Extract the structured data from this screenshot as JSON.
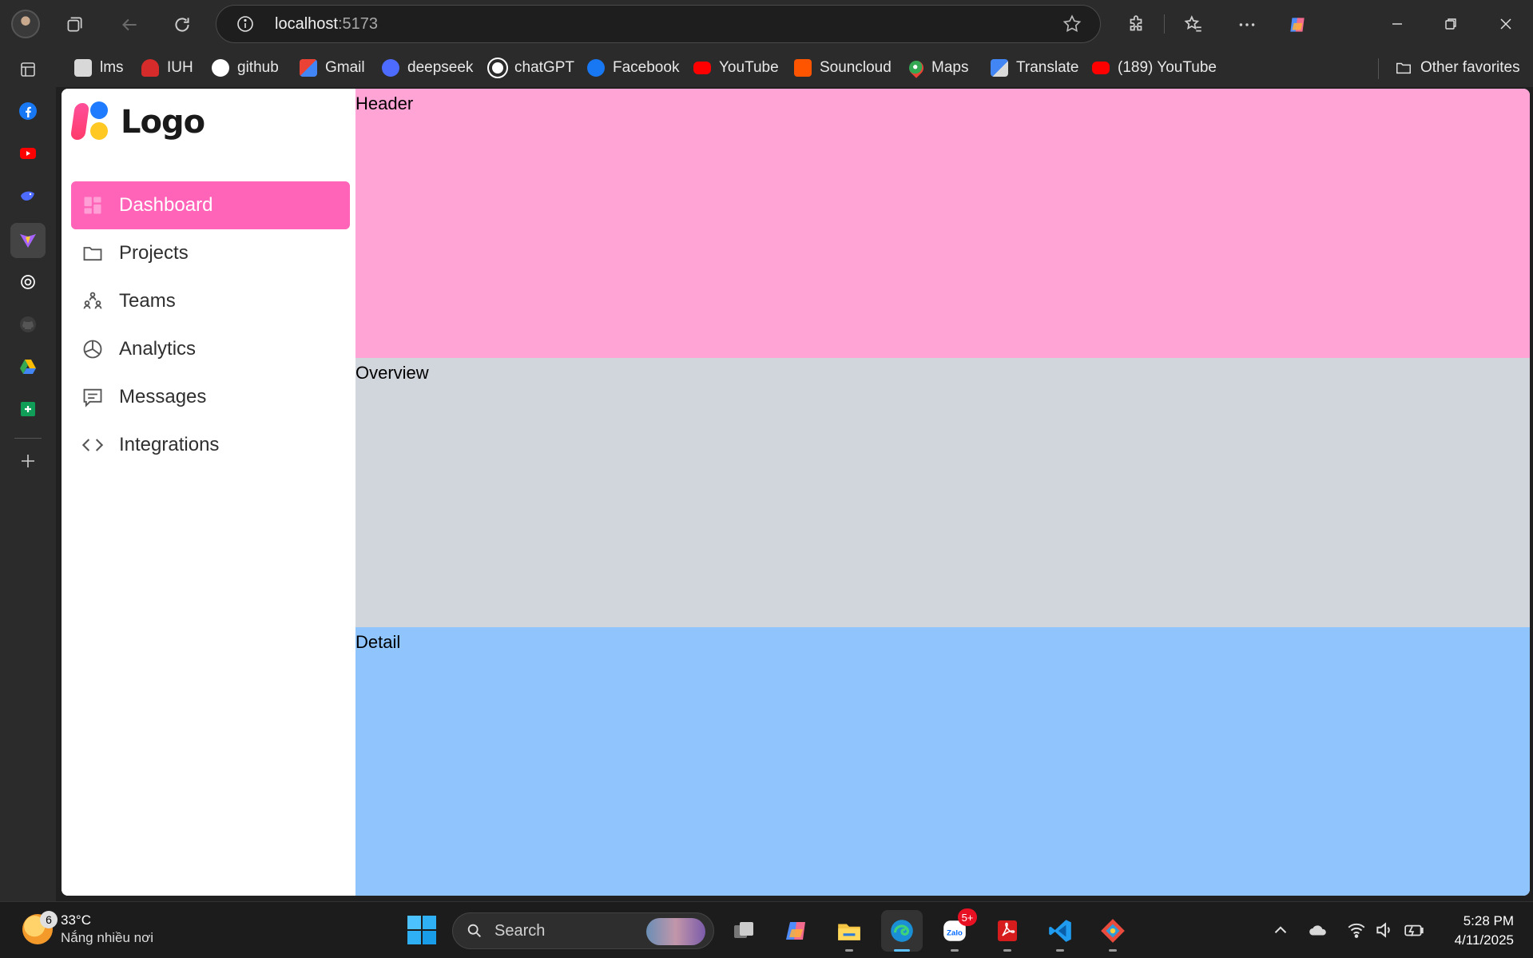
{
  "browser": {
    "url_host": "localhost",
    "url_port": ":5173"
  },
  "favorites": {
    "items": [
      {
        "label": "lms",
        "icon": "lms-icon",
        "color": "#d8d8d8"
      },
      {
        "label": "IUH",
        "icon": "iuh-icon",
        "color": "#d62b2b"
      },
      {
        "label": "github",
        "icon": "github-icon",
        "color": "#ffffff"
      },
      {
        "label": "Gmail",
        "icon": "gmail-icon",
        "color": "#ea4335"
      },
      {
        "label": "deepseek",
        "icon": "deepseek-icon",
        "color": "#4d6bfe"
      },
      {
        "label": "chatGPT",
        "icon": "chatgpt-icon",
        "color": "#ffffff"
      },
      {
        "label": "Facebook",
        "icon": "facebook-icon",
        "color": "#1877f2"
      },
      {
        "label": "YouTube",
        "icon": "youtube-icon",
        "color": "#ff0000"
      },
      {
        "label": "Souncloud",
        "icon": "soundcloud-icon",
        "color": "#ff5500"
      },
      {
        "label": "Maps",
        "icon": "maps-icon",
        "color": "#34a853"
      },
      {
        "label": "Translate",
        "icon": "translate-icon",
        "color": "#4285f4"
      },
      {
        "label": "(189) YouTube",
        "icon": "youtube-icon",
        "color": "#ff0000"
      }
    ],
    "other_label": "Other favorites"
  },
  "app": {
    "logo_text": "Logo",
    "accent": "#ff64b8",
    "nav": [
      {
        "label": "Dashboard",
        "icon": "dashboard-icon",
        "active": true
      },
      {
        "label": "Projects",
        "icon": "folder-icon",
        "active": false
      },
      {
        "label": "Teams",
        "icon": "teams-icon",
        "active": false
      },
      {
        "label": "Analytics",
        "icon": "pie-chart-icon",
        "active": false
      },
      {
        "label": "Messages",
        "icon": "message-icon",
        "active": false
      },
      {
        "label": "Integrations",
        "icon": "code-icon",
        "active": false
      }
    ],
    "panels": {
      "header": "Header",
      "overview": "Overview",
      "detail": "Detail"
    },
    "panel_colors": {
      "header": "#ffa4d5",
      "overview": "#d1d5dc",
      "detail": "#8fc4fd"
    }
  },
  "taskbar": {
    "weather_badge": "6",
    "weather_temp": "33°C",
    "weather_desc": "Nắng nhiều nơi",
    "search_label": "Search",
    "zalo_badge": "5+",
    "time": "5:28 PM",
    "date": "4/11/2025"
  }
}
